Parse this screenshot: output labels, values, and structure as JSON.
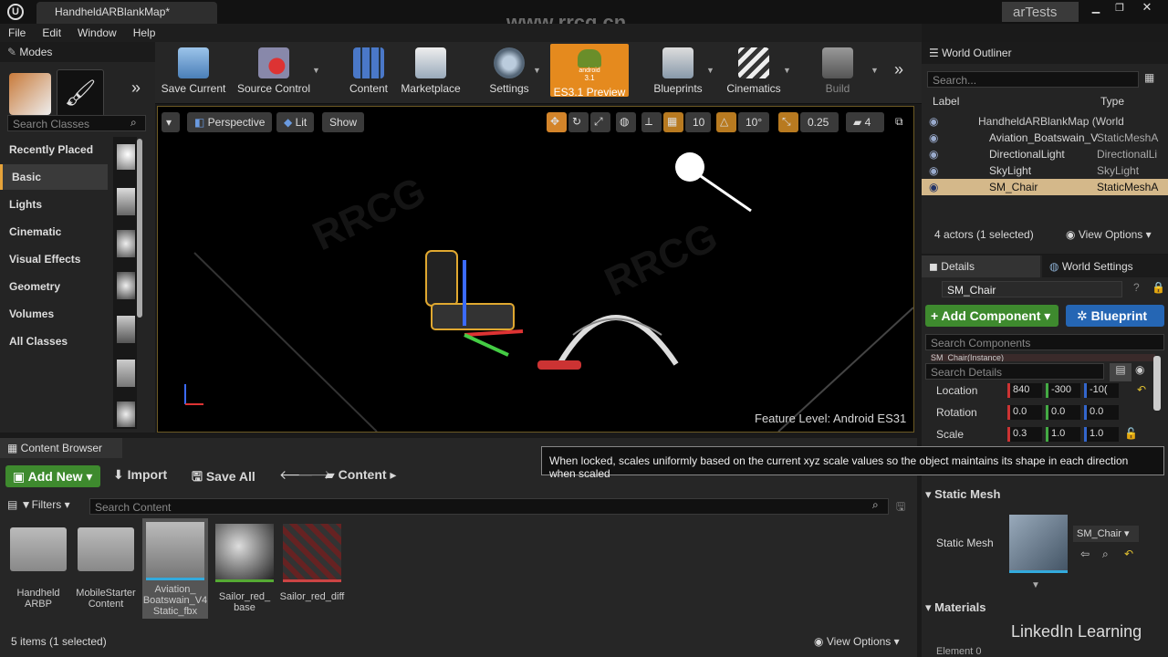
{
  "window": {
    "tab_title": "HandheldARBlankMap*",
    "project": "arTests",
    "watermark": "www.rrcg.cn"
  },
  "menu": [
    "File",
    "Edit",
    "Window",
    "Help"
  ],
  "modes": {
    "title": "Modes",
    "search_placeholder": "Search Classes",
    "categories": [
      "Recently Placed",
      "Basic",
      "Lights",
      "Cinematic",
      "Visual Effects",
      "Geometry",
      "Volumes",
      "All Classes"
    ],
    "selected": "Basic"
  },
  "toolbar": [
    {
      "label": "Save Current",
      "icon": "save-icon"
    },
    {
      "label": "Source Control",
      "icon": "source-control-icon"
    },
    {
      "label": "Content",
      "icon": "content-icon"
    },
    {
      "label": "Marketplace",
      "icon": "marketplace-icon"
    },
    {
      "label": "Settings",
      "icon": "settings-icon"
    },
    {
      "label": "ES3.1 Preview",
      "icon": "android-icon",
      "badge": "3.1",
      "sub": "android"
    },
    {
      "label": "Blueprints",
      "icon": "blueprints-icon"
    },
    {
      "label": "Cinematics",
      "icon": "cinematics-icon"
    },
    {
      "label": "Build",
      "icon": "build-icon"
    }
  ],
  "viewport": {
    "perspective": "Perspective",
    "lit": "Lit",
    "show": "Show",
    "grid": "10",
    "angle": "10°",
    "scale": "0.25",
    "camera_speed": "4",
    "feature_level_label": "Feature Level:",
    "feature_level": "Android ES31"
  },
  "outliner": {
    "title": "World Outliner",
    "search_placeholder": "Search...",
    "col_label": "Label",
    "col_type": "Type",
    "rows": [
      {
        "label": "HandheldARBlankMap (World",
        "type": ""
      },
      {
        "label": "Aviation_Boatswain_V",
        "type": "StaticMeshA"
      },
      {
        "label": "DirectionalLight",
        "type": "DirectionalLi"
      },
      {
        "label": "SkyLight",
        "type": "SkyLight"
      },
      {
        "label": "SM_Chair",
        "type": "StaticMeshA"
      }
    ],
    "status": "4 actors (1 selected)",
    "view_options": "View Options"
  },
  "details": {
    "tab": "Details",
    "tab2": "World Settings",
    "actor_name": "SM_Chair",
    "add_component": "+ Add Component",
    "blueprint": "Blueprint",
    "search_components": "Search Components",
    "instance_label": "SM_Chair(Instance)",
    "search_details": "Search Details",
    "transform": [
      {
        "label": "Location",
        "x": "840",
        "y": "-300",
        "z": "-10("
      },
      {
        "label": "Rotation",
        "x": "0.0",
        "y": "0.0",
        "z": "0.0"
      },
      {
        "label": "Scale",
        "x": "0.3",
        "y": "1.0",
        "z": "1.0"
      }
    ],
    "static_mesh_section": "Static Mesh",
    "static_mesh_label": "Static Mesh",
    "static_mesh_value": "SM_Chair",
    "materials_section": "Materials",
    "element": "Element 0"
  },
  "tooltip": "When locked, scales uniformly based on the current xyz scale values so the object maintains its shape in each direction when scaled",
  "content_browser": {
    "title": "Content Browser",
    "add_new": "Add New",
    "import": "Import",
    "save_all": "Save All",
    "path": "Content",
    "filters": "Filters",
    "search_placeholder": "Search Content",
    "assets": [
      {
        "name": "Handheld ARBP",
        "kind": "folder"
      },
      {
        "name": "MobileStarter Content",
        "kind": "folder"
      },
      {
        "name": "Aviation_ Boatswain_V4 Static_fbx",
        "kind": "mesh"
      },
      {
        "name": "Sailor_red_ base",
        "kind": "material"
      },
      {
        "name": "Sailor_red_diff",
        "kind": "texture"
      }
    ],
    "status": "5 items (1 selected)",
    "view_options": "View Options"
  },
  "branding": "LinkedIn Learning"
}
